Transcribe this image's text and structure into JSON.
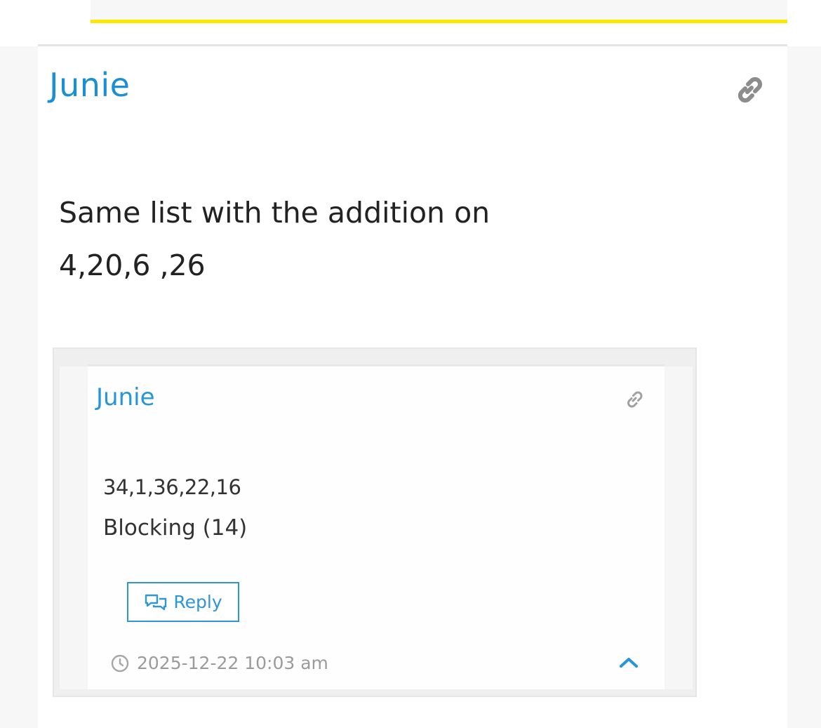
{
  "post": {
    "author": "Junie",
    "body_lines": [
      "Same list with the addition on",
      "4,20,6 ,26"
    ],
    "icons": {
      "permalink": "link-icon"
    }
  },
  "embedded_screenshot": {
    "author": "Junie",
    "line1": "34,1,36,22,16",
    "line2": "Blocking (14)",
    "reply_label": "Reply",
    "timestamp": "2025-12-22 10:03 am",
    "icons": {
      "permalink": "link-icon",
      "reply": "chat-bubbles-icon",
      "time": "clock-icon",
      "collapse": "chevron-up-icon"
    }
  },
  "colors": {
    "accent": "#1a8fd3",
    "highlight_bar": "#ffe600",
    "text": "#222222",
    "muted": "#9b9b9b",
    "icon_gray": "#8c8c8c"
  }
}
